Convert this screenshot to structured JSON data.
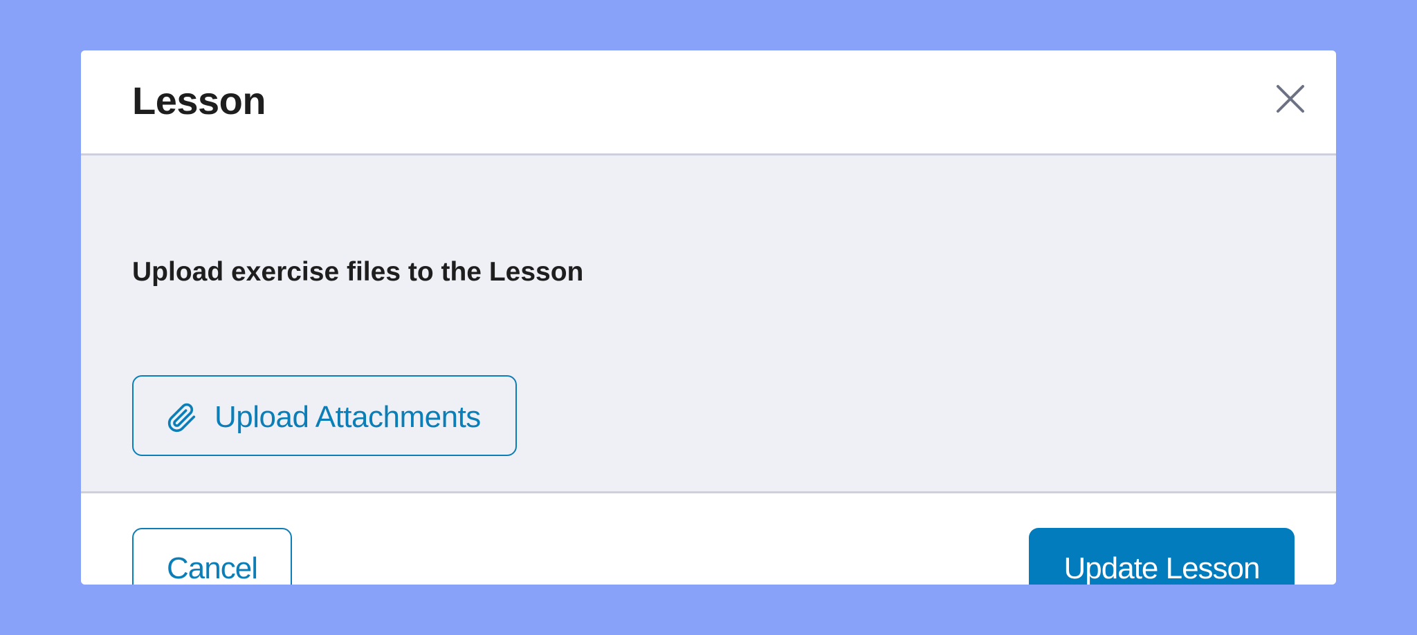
{
  "dialog": {
    "title": "Lesson",
    "close_icon": "close-icon"
  },
  "body": {
    "label": "Upload exercise files to the Lesson",
    "upload_button": {
      "label": "Upload Attachments",
      "icon": "paperclip-icon"
    }
  },
  "footer": {
    "cancel_label": "Cancel",
    "submit_label": "Update Lesson"
  },
  "colors": {
    "backdrop": "#87a2f8",
    "accent": "#027cbd",
    "outline": "#0b7eb8",
    "body_bg": "#eff0f5"
  }
}
